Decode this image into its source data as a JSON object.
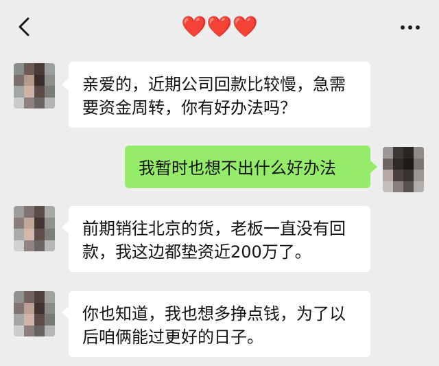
{
  "header": {
    "back_icon": "chevron-left-icon",
    "title": "❤️❤️❤️",
    "more_icon": "more-dots-icon"
  },
  "messages": [
    {
      "side": "left",
      "text": "亲爱的，近期公司回款比较慢，急需要资金周转，你有好办法吗？"
    },
    {
      "side": "right",
      "text": "我暂时也想不出什么好办法"
    },
    {
      "side": "left",
      "text": "前期销往北京的货，老板一直没有回款，我这边都垫资近200万了。"
    },
    {
      "side": "left",
      "text": "你也知道，我也想多挣点钱，为了以后咱俩能过更好的日子。"
    }
  ],
  "colors": {
    "background": "#ededed",
    "left_bubble": "#ffffff",
    "right_bubble": "#95ec69"
  }
}
